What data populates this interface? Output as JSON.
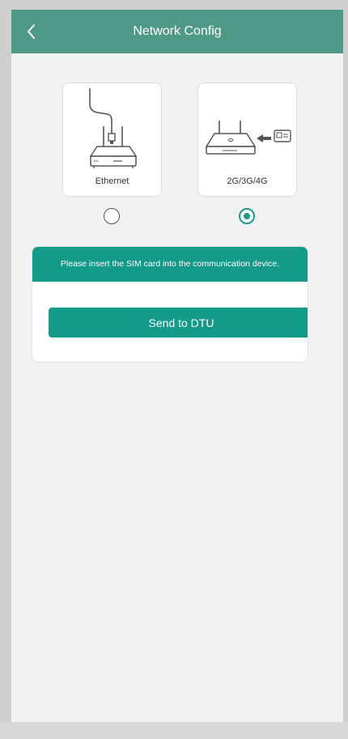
{
  "header": {
    "title": "Network Config",
    "back_icon": "chevron-left-icon"
  },
  "options": [
    {
      "label": "Ethernet",
      "icon": "ethernet-router-icon",
      "selected": false
    },
    {
      "label": "2G/3G/4G",
      "icon": "sim-router-icon",
      "selected": true
    }
  ],
  "info": {
    "message": "Please insert the SIM card into the communication device.",
    "button_label": "Send to DTU"
  },
  "colors": {
    "header": "#4f9a86",
    "accent": "#149a88",
    "background": "#f2f2f2"
  }
}
